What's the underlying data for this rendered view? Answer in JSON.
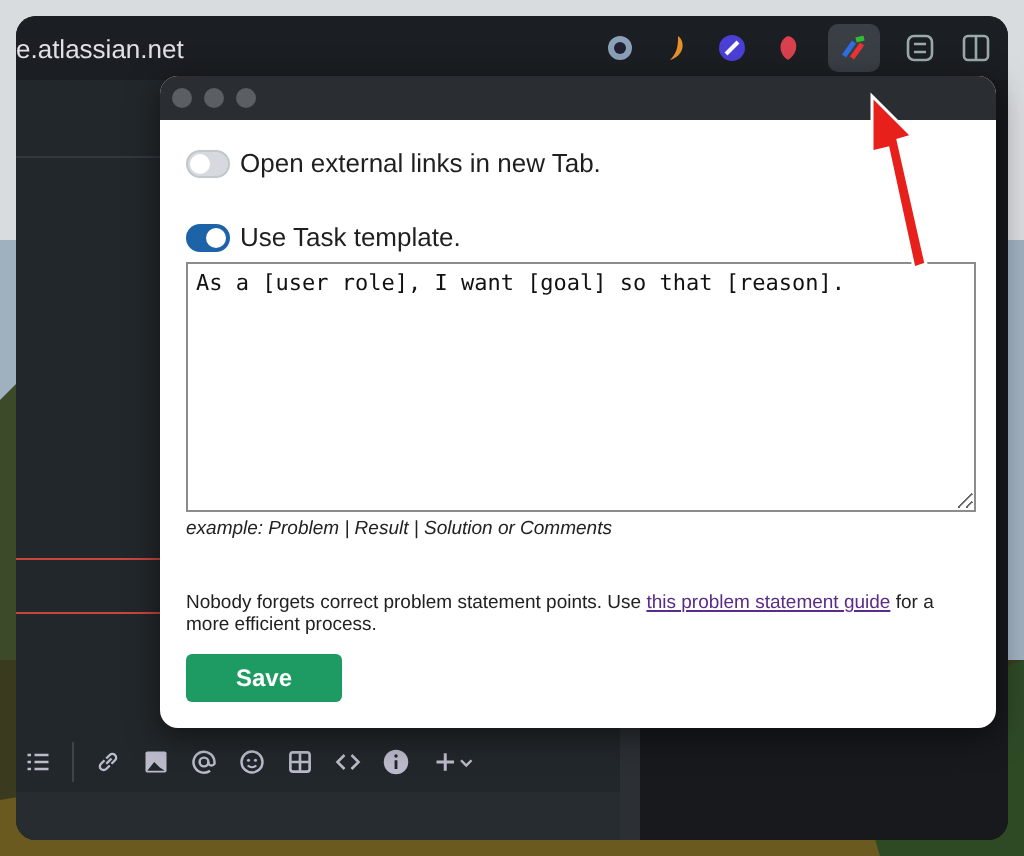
{
  "browser": {
    "url": "e.atlassian.net"
  },
  "popup": {
    "toggles": [
      {
        "label": "Open external links in new Tab.",
        "on": false
      },
      {
        "label": "Use Task template.",
        "on": true
      }
    ],
    "template": {
      "value": "As a [user role], I want [goal] so that [reason]."
    },
    "hint": "example: Problem | Result | Solution or Comments",
    "note": {
      "before": "Nobody forgets correct problem statement points. Use ",
      "link": "this problem statement guide",
      "after": " for a more efficient process."
    },
    "save_button": "Save"
  }
}
